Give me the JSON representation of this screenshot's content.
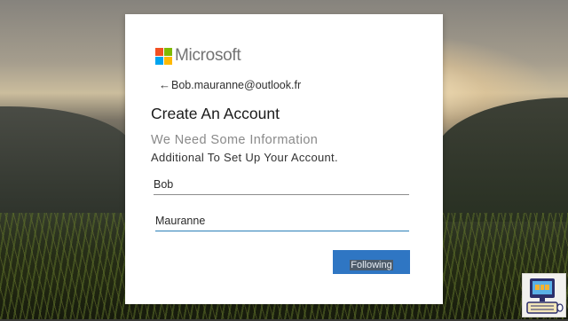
{
  "brand": {
    "name": "Microsoft",
    "logo_colors": [
      "#f25022",
      "#7fba00",
      "#00a4ef",
      "#ffb900"
    ]
  },
  "account": {
    "back_arrow": "←",
    "email": "Bob.mauranne@outlook.fr"
  },
  "heading": {
    "title": "Create An Account",
    "subtitle_line1": "We Need Some Information",
    "subtitle_line2": "Additional To Set Up Your Account."
  },
  "form": {
    "first_name_value": "Bob",
    "last_name_value": "Mauranne",
    "next_label": "Following"
  },
  "colors": {
    "button": "#2f76c3",
    "focus_underline": "#2b7fb8"
  },
  "overlay": {
    "badge_icon": "computer-keyboard-icon"
  }
}
